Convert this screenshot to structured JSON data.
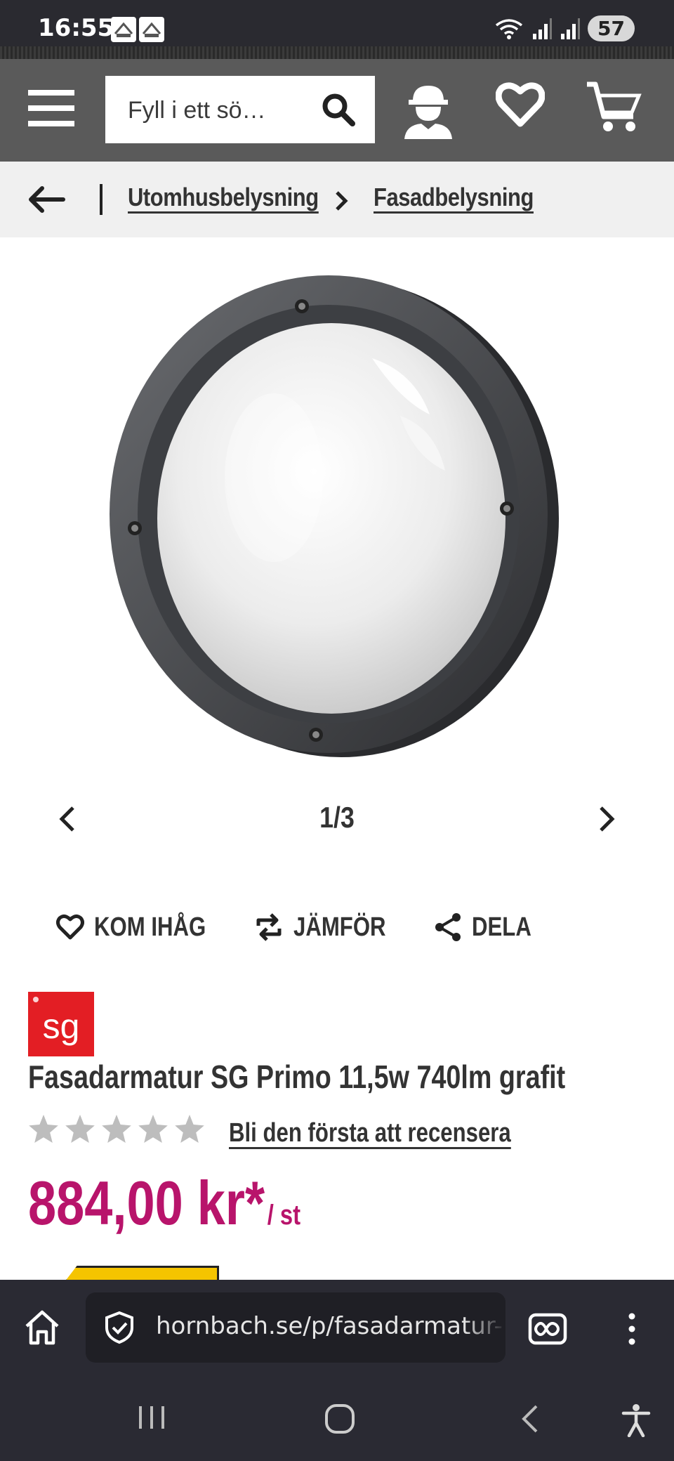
{
  "status_bar": {
    "time": "16:55",
    "battery": "57"
  },
  "header": {
    "search_placeholder": "Fyll i ett sö…"
  },
  "breadcrumb": {
    "items": [
      "Utomhusbelysning",
      "Fasadbelysning"
    ]
  },
  "gallery": {
    "counter": "1/3"
  },
  "actions": {
    "remember": "KOM IHÅG",
    "compare": "JÄMFÖR",
    "share": "DELA"
  },
  "product": {
    "brand_logo": "sg",
    "title": "Fasadarmatur SG Primo 11,5w 740lm grafit",
    "rating_stars": 0,
    "review_link": "Bli den första att recensera",
    "price": "884,00 kr*",
    "price_unit": "/ st"
  },
  "browser": {
    "url": "hornbach.se/p/fasadarmatur-"
  },
  "colors": {
    "header_bg": "#5a5a5a",
    "price": "#b8146b",
    "brand": "#e31e24"
  },
  "icons": [
    "menu-icon",
    "search-icon",
    "account-icon",
    "heart-icon",
    "cart-icon",
    "back-arrow-icon",
    "chevron-right-icon",
    "chevron-left-icon",
    "compare-icon",
    "share-icon",
    "star-icon",
    "home-icon",
    "shield-icon",
    "extension-icon",
    "more-icon",
    "recents-icon",
    "home-circle-icon",
    "nav-back-icon",
    "accessibility-icon"
  ]
}
